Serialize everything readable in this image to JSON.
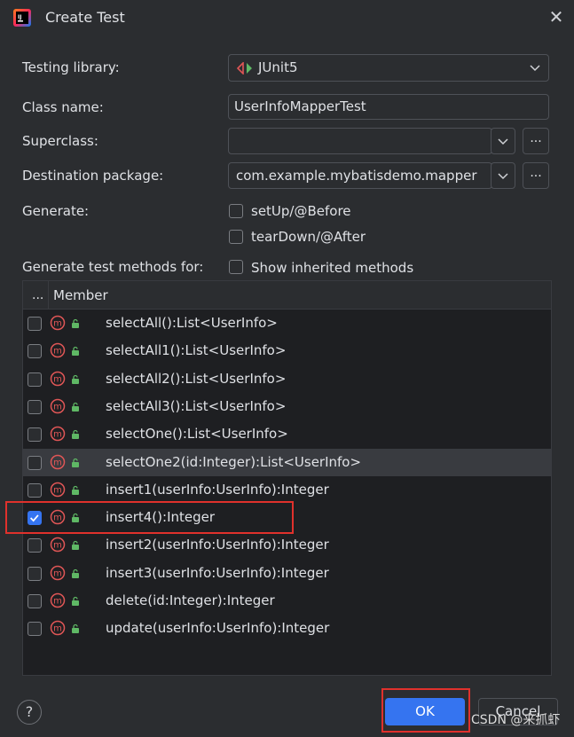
{
  "window": {
    "title": "Create Test"
  },
  "form": {
    "testing_library_label": "Testing library:",
    "testing_library_value": "JUnit5",
    "class_name_label": "Class name:",
    "class_name_value": "UserInfoMapperTest",
    "superclass_label": "Superclass:",
    "superclass_value": "",
    "dest_package_label": "Destination package:",
    "dest_package_value": "com.example.mybatisdemo.mapper",
    "browse_label": "...",
    "generate_label": "Generate:",
    "setup_label": "setUp/@Before",
    "teardown_label": "tearDown/@After",
    "gen_methods_label": "Generate test methods for:",
    "show_inherited_label": "Show inherited methods"
  },
  "table": {
    "col_dots": "...",
    "col_member": "Member",
    "rows": [
      {
        "text": "selectAll():List<UserInfo>",
        "checked": false
      },
      {
        "text": "selectAll1():List<UserInfo>",
        "checked": false
      },
      {
        "text": "selectAll2():List<UserInfo>",
        "checked": false
      },
      {
        "text": "selectAll3():List<UserInfo>",
        "checked": false
      },
      {
        "text": "selectOne():List<UserInfo>",
        "checked": false
      },
      {
        "text": "selectOne2(id:Integer):List<UserInfo>",
        "checked": false
      },
      {
        "text": "insert1(userInfo:UserInfo):Integer",
        "checked": false
      },
      {
        "text": "insert4():Integer",
        "checked": true
      },
      {
        "text": "insert2(userInfo:UserInfo):Integer",
        "checked": false
      },
      {
        "text": "insert3(userInfo:UserInfo):Integer",
        "checked": false
      },
      {
        "text": "delete(id:Integer):Integer",
        "checked": false
      },
      {
        "text": "update(userInfo:UserInfo):Integer",
        "checked": false
      }
    ]
  },
  "buttons": {
    "help": "?",
    "ok": "OK",
    "cancel": "Cancel"
  },
  "watermark": "CSDN @来抓虾",
  "colors": {
    "accent": "#3574f0",
    "highlight_box": "#e0312c",
    "method_icon": "#e05656",
    "lock_icon": "#5fb865"
  }
}
